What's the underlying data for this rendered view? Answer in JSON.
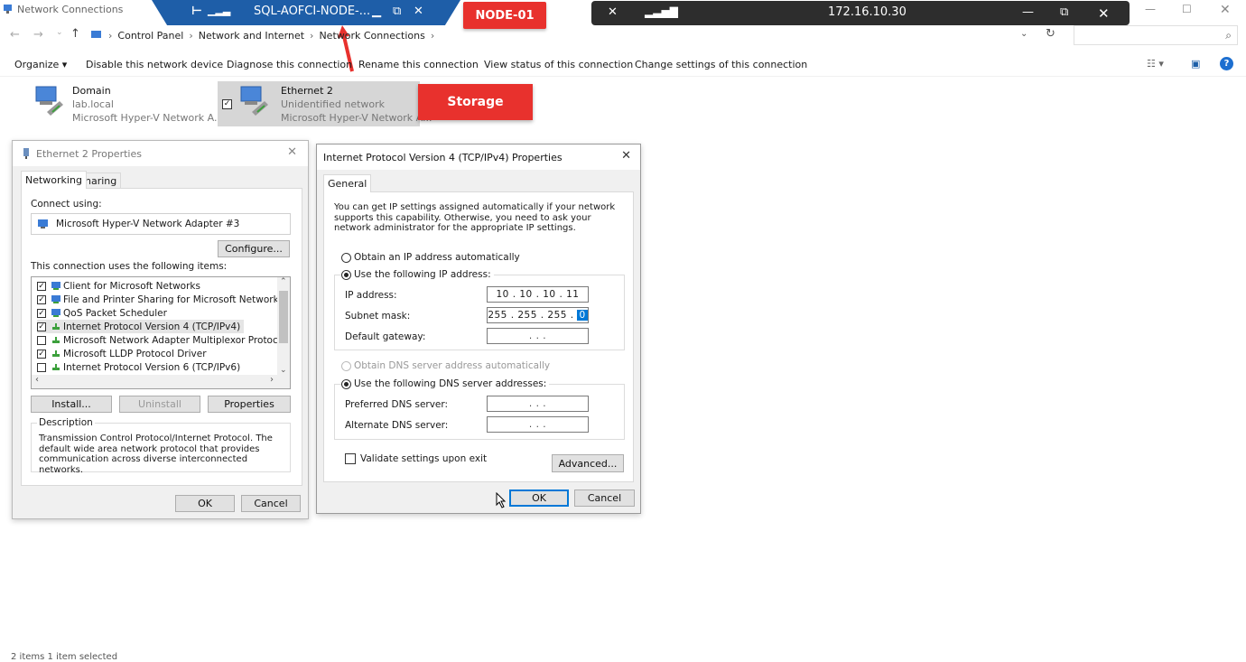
{
  "window": {
    "title": "Network Connections"
  },
  "rdp_session": {
    "name": "SQL-AOFCI-NODE-...",
    "node_label": "NODE-01"
  },
  "rdp_remote": {
    "address": "172.16.10.30"
  },
  "address_bar": {
    "breadcrumbs": [
      "Control Panel",
      "Network and Internet",
      "Network Connections"
    ]
  },
  "command_bar": {
    "organize": "Organize ▾",
    "items": [
      "Disable this network device",
      "Diagnose this connection",
      "Rename this connection",
      "View status of this connection",
      "Change settings of this connection"
    ]
  },
  "adapters": [
    {
      "name": "Domain",
      "status": "lab.local",
      "device": "Microsoft Hyper-V Network A..."
    },
    {
      "name": "Ethernet 2",
      "status": "Unidentified network",
      "device": "Microsoft Hyper-V Network A..."
    }
  ],
  "storage_label": "Storage",
  "eth_props": {
    "title": "Ethernet 2 Properties",
    "tabs": [
      "Networking",
      "Sharing"
    ],
    "connect_using_label": "Connect using:",
    "adapter": "Microsoft Hyper-V Network Adapter #3",
    "configure": "Configure...",
    "items_label": "This connection uses the following items:",
    "items": [
      {
        "label": "Client for Microsoft Networks",
        "checked": true
      },
      {
        "label": "File and Printer Sharing for Microsoft Networks",
        "checked": true
      },
      {
        "label": "QoS Packet Scheduler",
        "checked": true
      },
      {
        "label": "Internet Protocol Version 4 (TCP/IPv4)",
        "checked": true
      },
      {
        "label": "Microsoft Network Adapter Multiplexor Protocol",
        "checked": false
      },
      {
        "label": "Microsoft LLDP Protocol Driver",
        "checked": true
      },
      {
        "label": "Internet Protocol Version 6 (TCP/IPv6)",
        "checked": false
      }
    ],
    "install": "Install...",
    "uninstall": "Uninstall",
    "properties": "Properties",
    "description_label": "Description",
    "description": "Transmission Control Protocol/Internet Protocol. The default wide area network protocol that provides communication across diverse interconnected networks.",
    "ok": "OK",
    "cancel": "Cancel"
  },
  "ipv4": {
    "title": "Internet Protocol Version 4 (TCP/IPv4) Properties",
    "tab": "General",
    "intro": "You can get IP settings assigned automatically if your network supports this capability. Otherwise, you need to ask your network administrator for the appropriate IP settings.",
    "obtain_ip_auto": "Obtain an IP address automatically",
    "use_following_ip": "Use the following IP address:",
    "ip_label": "IP address:",
    "ip_value": "10 . 10 . 10 . 11",
    "subnet_label": "Subnet mask:",
    "subnet_value": "255 . 255 . 255 .",
    "subnet_selected": "0",
    "gateway_label": "Default gateway:",
    "gateway_value": ".     .     .",
    "obtain_dns_auto": "Obtain DNS server address automatically",
    "use_following_dns": "Use the following DNS server addresses:",
    "preferred_dns_label": "Preferred DNS server:",
    "preferred_dns_value": ".     .     .",
    "alternate_dns_label": "Alternate DNS server:",
    "alternate_dns_value": ".     .     .",
    "validate": "Validate settings upon exit",
    "advanced": "Advanced...",
    "ok": "OK",
    "cancel": "Cancel"
  },
  "status_bar": {
    "text": "2 items     1 item selected"
  }
}
